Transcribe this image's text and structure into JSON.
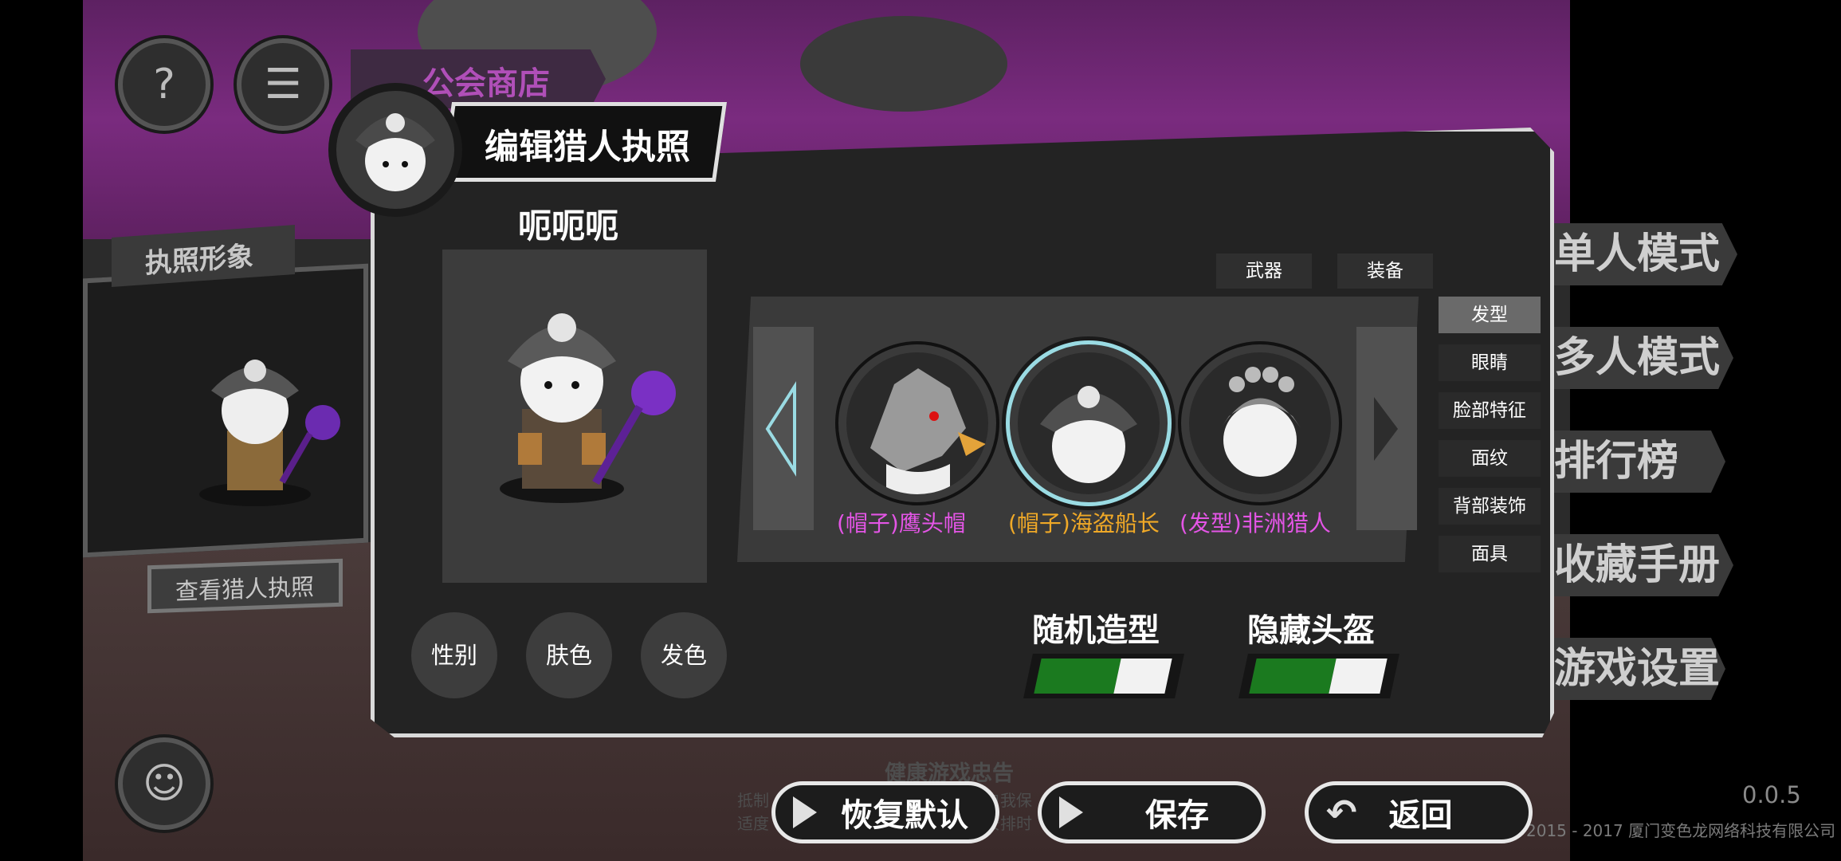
{
  "background": {
    "side_menu": [
      "单人模式",
      "多人模式",
      "排行榜",
      "收藏手册",
      "游戏设置"
    ],
    "guild_shop_label": "公会商店",
    "license_image_label": "执照形象",
    "view_license_button": "查看猎人执照",
    "health_notice_title": "健康游戏忠告",
    "health_notice_line1": "抵制",
    "health_notice_line1b": "自我保",
    "health_notice_line2": "适度",
    "health_notice_line2b": "安排时",
    "version": "0.0.5",
    "copyright": "2015 - 2017 厦门变色龙网络科技有限公司"
  },
  "dialog": {
    "title": "编辑猎人执照",
    "player_name": "呃呃呃",
    "top_tabs": [
      "武器",
      "装备"
    ],
    "category_tabs": [
      "发型",
      "眼睛",
      "脸部特征",
      "面纹",
      "背部装饰",
      "面具"
    ],
    "active_category": "发型",
    "items": [
      {
        "label": "(帽子)鹰头帽",
        "color": "#e455e6"
      },
      {
        "label": "(帽子)海盗船长",
        "color": "#f0a927"
      },
      {
        "label": "(发型)非洲猎人",
        "color": "#e455e6"
      }
    ],
    "selected_item_index": 1,
    "appearance_buttons": [
      "性别",
      "肤色",
      "发色"
    ],
    "toggles": [
      {
        "label": "随机造型",
        "on": true
      },
      {
        "label": "隐藏头盔",
        "on": true
      }
    ]
  },
  "bottom_buttons": [
    "恢复默认",
    "保存",
    "返回"
  ],
  "colors": {
    "toggle_on": "#1b7a1f",
    "selected_ring": "#9adbe3",
    "accent_purple": "#7a2b7f"
  }
}
